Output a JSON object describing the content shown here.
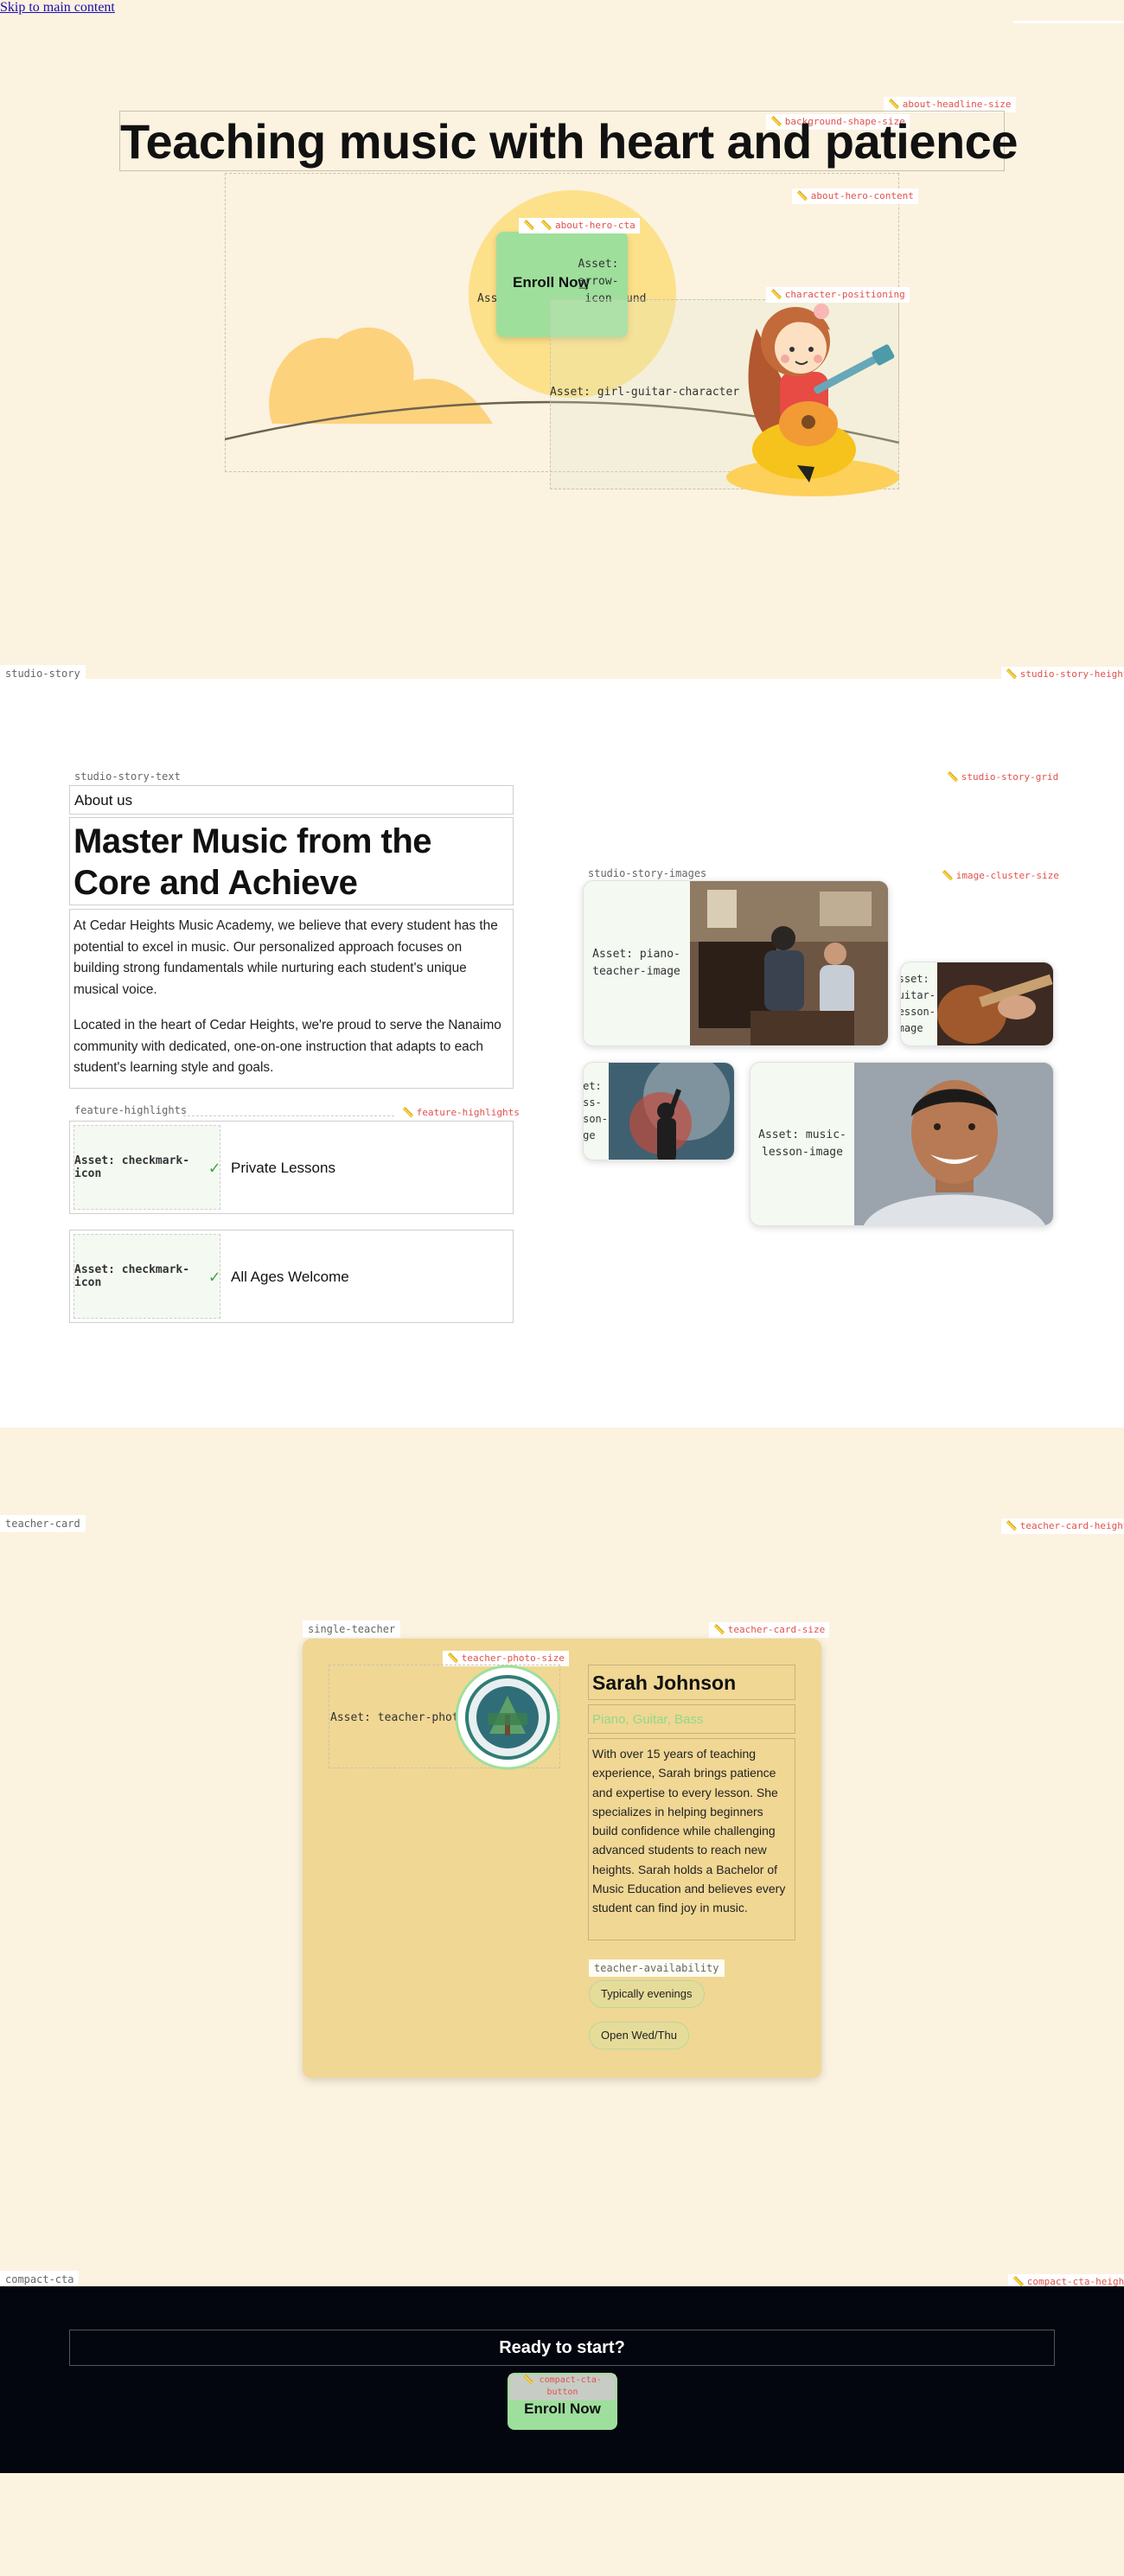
{
  "skip_link": "Skip to main content",
  "hero": {
    "headline": "Teaching music with heart and patience",
    "cta_label": "Enroll Now",
    "arrow_asset": "Asset:\narrow-\nicon",
    "bg_asset_left": "Ass",
    "bg_asset_right": "und",
    "character_asset": "Asset: girl-guitar-character",
    "ruler_headline": "about-headline-size",
    "ruler_bg_shape": "background-shape-size",
    "ruler_hero_content": "about-hero-content",
    "ruler_hero_cta": "about-hero-cta",
    "ruler_character": "character-positioning"
  },
  "studio_story": {
    "section_label": "studio-story",
    "ruler_height": "studio-story-height",
    "ruler_grid": "studio-story-grid",
    "text_label": "studio-story-text",
    "eyebrow": "About us",
    "heading": "Master Music from the Core and Achieve Excellence",
    "paragraph1": "At Cedar Heights Music Academy, we believe that every student has the potential to excel in music. Our personalized approach focuses on building strong fundamentals while nurturing each student's unique musical voice.",
    "paragraph2": "Located in the heart of Cedar Heights, we're proud to serve the Nanaimo community with dedicated, one-on-one instruction that adapts to each student's learning style and goals.",
    "features_label": "feature-highlights",
    "ruler_features": "feature-highlights",
    "features": [
      {
        "asset": "Asset: checkmark-icon",
        "check": "✓",
        "text": "Private Lessons"
      },
      {
        "asset": "Asset: checkmark-icon",
        "check": "✓",
        "text": "All Ages Welcome"
      }
    ],
    "images_label": "studio-story-images",
    "ruler_cluster": "image-cluster-size",
    "images": [
      {
        "asset": "Asset: piano-\nteacher-image"
      },
      {
        "asset": "Asset:\nguitar-\nlesson-\nimage"
      },
      {
        "asset": "Asset:\nclass-\nlesson-\nimage"
      },
      {
        "asset": "Asset: music-\nlesson-image"
      }
    ]
  },
  "teacher": {
    "section_label": "teacher-card",
    "ruler_height": "teacher-card-height",
    "card_label": "single-teacher",
    "ruler_size": "teacher-card-size",
    "ruler_photo": "teacher-photo-size",
    "photo_asset": "Asset: teacher-photo",
    "name": "Sarah Johnson",
    "instruments": "Piano, Guitar, Bass",
    "bio": "With over 15 years of teaching experience, Sarah brings patience and expertise to every lesson. She specializes in helping beginners build confidence while challenging advanced students to reach new heights. Sarah holds a Bachelor of Music Education and believes every student can find joy in music.",
    "availability_label": "teacher-availability",
    "availability": [
      "Typically evenings",
      "Open Wed/Thu"
    ]
  },
  "cta": {
    "section_label": "compact-cta",
    "ruler_height": "compact-cta-height",
    "heading": "Ready to start?",
    "ruler_button": "compact-cta-button",
    "button_label": "Enroll Now"
  },
  "colors": {
    "page_bg": "#fbf2e0",
    "accent_green": "#9edf9c",
    "card_gold": "#f0d794",
    "cta_dark": "#03060f",
    "ruler_red": "#e0524c"
  }
}
